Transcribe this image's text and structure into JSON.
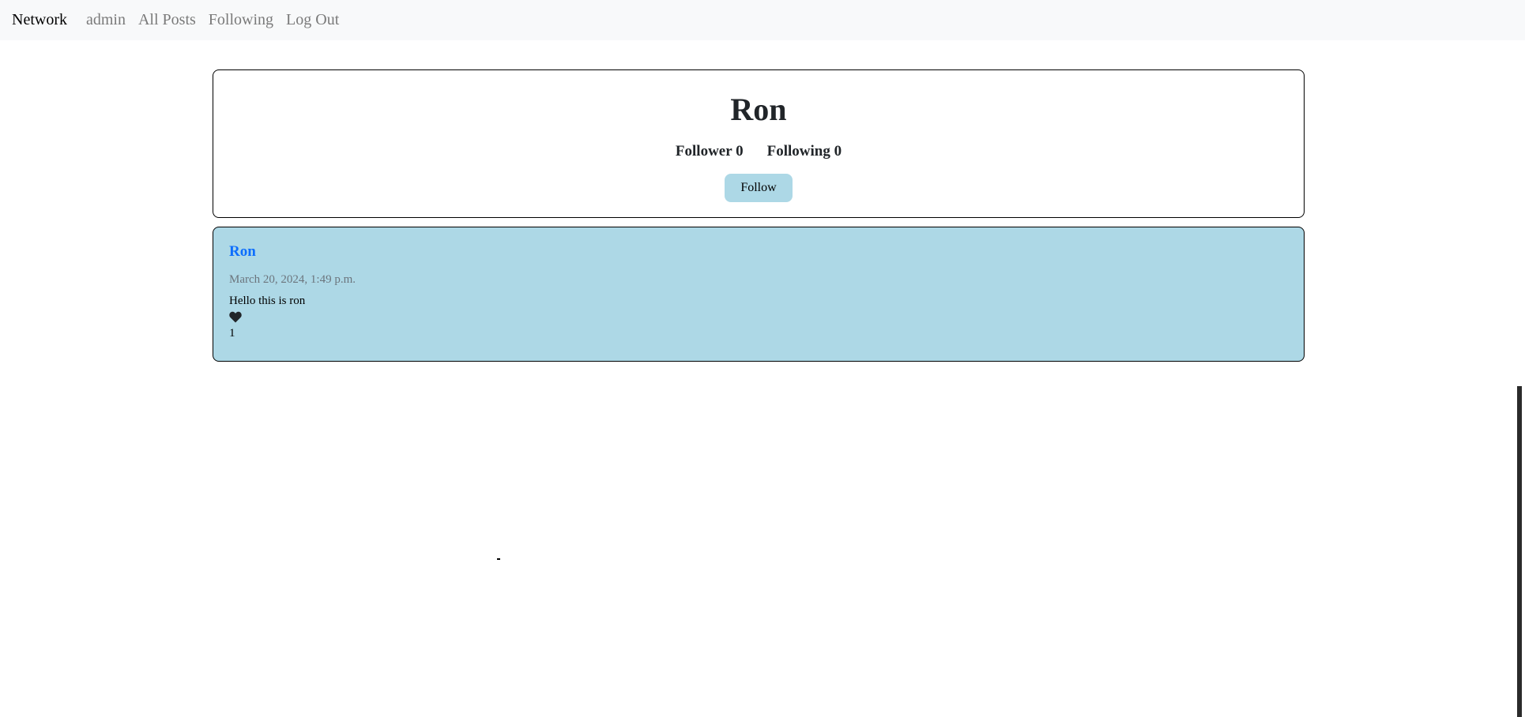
{
  "navbar": {
    "brand": "Network",
    "links": [
      "admin",
      "All Posts",
      "Following",
      "Log Out"
    ]
  },
  "profile": {
    "name": "Ron",
    "follower_label": "Follower 0",
    "following_label": "Following 0",
    "follow_button": "Follow"
  },
  "posts": [
    {
      "author": "Ron",
      "timestamp": "March 20, 2024, 1:49 p.m.",
      "content": "Hello this is ron",
      "like_icon": "heart-icon",
      "likes": "1"
    }
  ],
  "colors": {
    "navbar_bg": "#f8f9fa",
    "post_bg": "#add8e6",
    "button_bg": "#add8e6",
    "author_link": "#0d6efd"
  }
}
